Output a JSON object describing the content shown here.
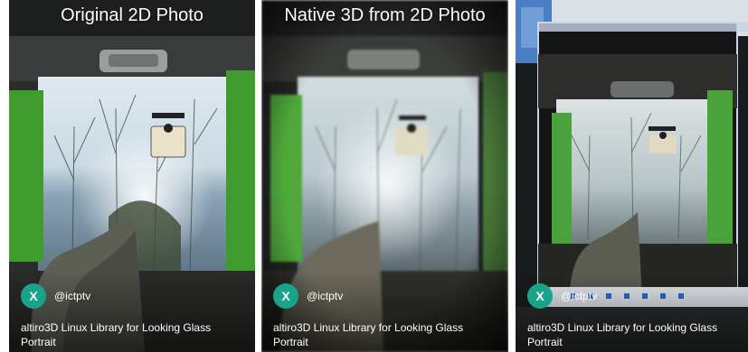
{
  "accent": "#1aa38a",
  "panels": [
    {
      "title": "Original 2D Photo",
      "avatar_letter": "X",
      "handle": "@ictptv",
      "caption": "altiro3D Linux Library for Looking Glass Portrait"
    },
    {
      "title": "Native 3D from 2D Photo",
      "avatar_letter": "X",
      "handle": "@ictptv",
      "caption": "altiro3D Linux Library for Looking Glass Portrait"
    },
    {
      "title": "",
      "avatar_letter": "X",
      "handle": "@ictptv",
      "caption": "altiro3D Linux Library for Looking Glass Portrait"
    }
  ]
}
